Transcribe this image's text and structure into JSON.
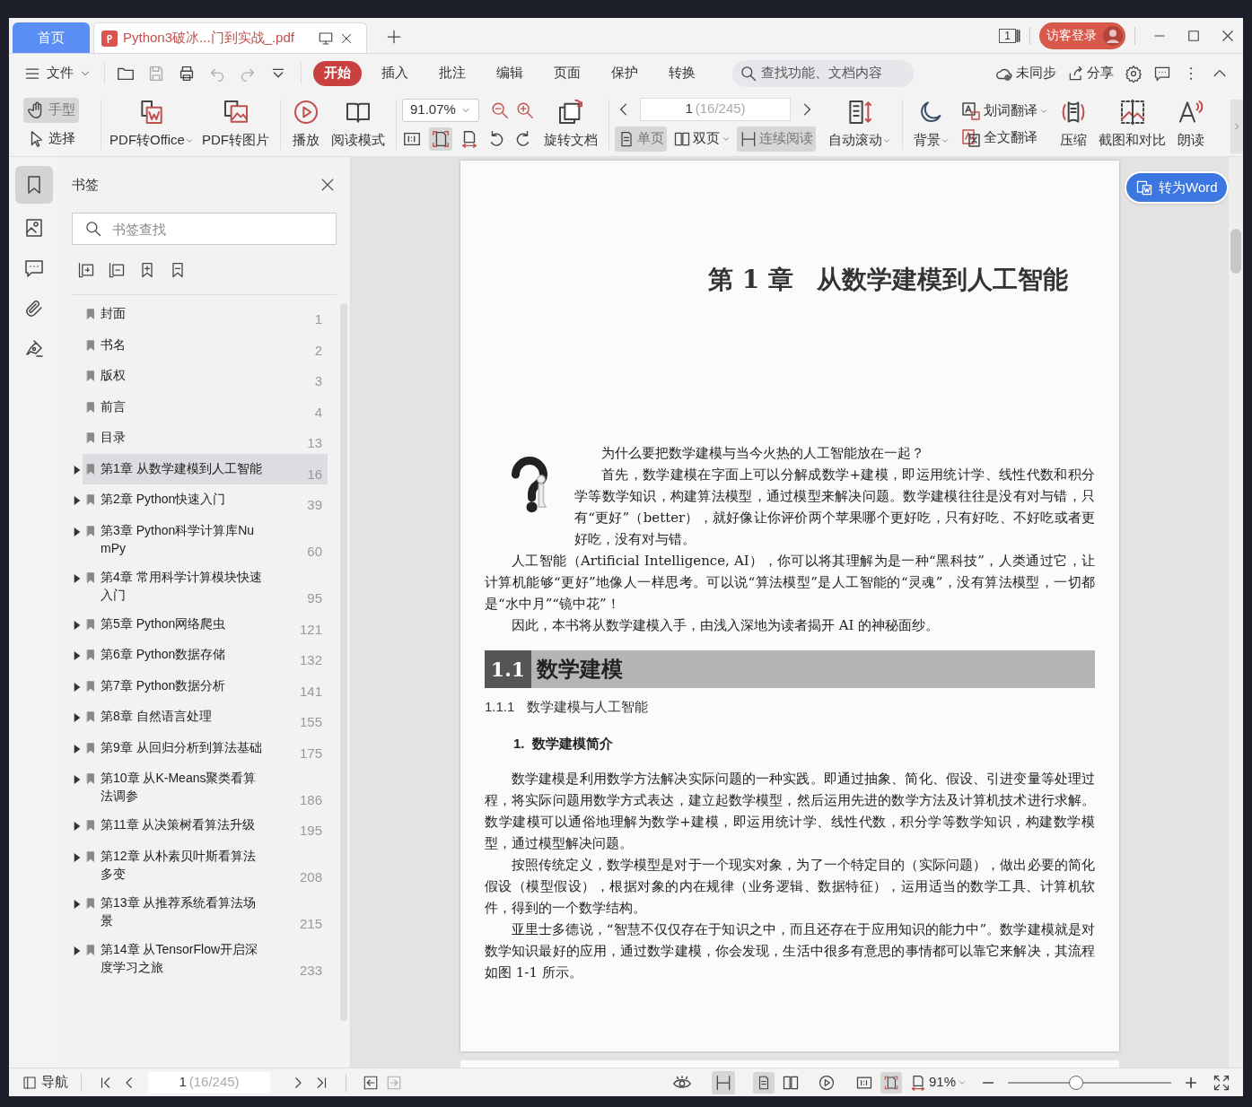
{
  "window": {
    "tabs": [
      {
        "label": "首页",
        "kind": "home",
        "selected": false
      },
      {
        "label": "Python3破冰...门到实战_.pdf",
        "kind": "document",
        "selected": true
      }
    ],
    "page_badge": "1",
    "login_button": "访客登录"
  },
  "menu": {
    "file": "文件",
    "ribbon_tabs": [
      {
        "label": "开始",
        "selected": true
      },
      {
        "label": "插入",
        "selected": false
      },
      {
        "label": "批注",
        "selected": false
      },
      {
        "label": "编辑",
        "selected": false
      },
      {
        "label": "页面",
        "selected": false
      },
      {
        "label": "保护",
        "selected": false
      },
      {
        "label": "转换",
        "selected": false
      }
    ],
    "search": {
      "placeholder": "查找功能、文档内容"
    },
    "sync": "未同步",
    "share": "分享"
  },
  "toolbar": {
    "pointer_tools": [
      {
        "label": "手型",
        "selected": true
      },
      {
        "label": "选择",
        "selected": false
      }
    ],
    "convert_tools": [
      {
        "label": "PDF转Office",
        "dropdown": true
      },
      {
        "label": "PDF转图片"
      },
      {
        "label": "播放"
      },
      {
        "label": "阅读模式"
      }
    ],
    "zoom": "91.07%",
    "rotate": "旋转文档",
    "page": {
      "value": "1",
      "total": "(16/245)"
    },
    "view_modes": [
      {
        "label": "单页",
        "selected": true
      },
      {
        "label": "双页",
        "selected": false,
        "dropdown": true
      },
      {
        "label": "连续阅读",
        "selected": true
      }
    ],
    "auto_scroll": "自动滚动",
    "background": "背景",
    "translate": [
      "划词翻译",
      "全文翻译"
    ],
    "more_tools": [
      "压缩",
      "截图和对比",
      "朗读"
    ]
  },
  "sidebar": {
    "title": "书签",
    "search": {
      "placeholder": "书签查找"
    },
    "bookmarks": [
      {
        "title": "封面",
        "page": "1",
        "has_children": false,
        "selected": false
      },
      {
        "title": "书名",
        "page": "2",
        "has_children": false,
        "selected": false
      },
      {
        "title": "版权",
        "page": "3",
        "has_children": false,
        "selected": false
      },
      {
        "title": "前言",
        "page": "4",
        "has_children": false,
        "selected": false
      },
      {
        "title": "目录",
        "page": "13",
        "has_children": false,
        "selected": false
      },
      {
        "title": "第1章 从数学建模到人工智能",
        "page": "16",
        "has_children": true,
        "selected": true
      },
      {
        "title": "第2章 Python快速入门",
        "page": "39",
        "has_children": true,
        "selected": false
      },
      {
        "title": "第3章 Python科学计算库NumPy",
        "page": "60",
        "has_children": true,
        "selected": false
      },
      {
        "title": "第4章 常用科学计算模块快速入门",
        "page": "95",
        "has_children": true,
        "selected": false
      },
      {
        "title": "第5章 Python网络爬虫",
        "page": "121",
        "has_children": true,
        "selected": false
      },
      {
        "title": "第6章 Python数据存储",
        "page": "132",
        "has_children": true,
        "selected": false
      },
      {
        "title": "第7章 Python数据分析",
        "page": "141",
        "has_children": true,
        "selected": false
      },
      {
        "title": "第8章 自然语言处理",
        "page": "155",
        "has_children": true,
        "selected": false
      },
      {
        "title": "第9章 从回归分析到算法基础",
        "page": "175",
        "has_children": true,
        "selected": false
      },
      {
        "title": "第10章 从K-Means聚类看算法调参",
        "page": "186",
        "has_children": true,
        "selected": false
      },
      {
        "title": "第11章 从决策树看算法升级",
        "page": "195",
        "has_children": true,
        "selected": false
      },
      {
        "title": "第12章 从朴素贝叶斯看算法多变",
        "page": "208",
        "has_children": true,
        "selected": false
      },
      {
        "title": "第13章 从推荐系统看算法场景",
        "page": "215",
        "has_children": true,
        "selected": false
      },
      {
        "title": "第14章 从TensorFlow开启深度学习之旅",
        "page": "233",
        "has_children": true,
        "selected": false
      }
    ]
  },
  "document": {
    "chapter_number": "第 1 章",
    "chapter_name": "从数学建模到人工智能",
    "intro": [
      "为什么要把数学建模与当今火热的人工智能放在一起？",
      "首先，数学建模在字面上可以分解成数学+建模，即运用统计学、线性代数和积分学等数学知识，构建算法模型，通过模型来解决问题。数学建模往往是没有对与错，只有“更好”（better），就好像让你评价两个苹果哪个更好吃，只有好吃、不好吃或者更好吃，没有对与错。",
      "人工智能（Artificial Intelligence, AI），你可以将其理解为是一种“黑科技”，人类通过它，让计算机能够“更好”地像人一样思考。可以说“算法模型”是人工智能的“灵魂”，没有算法模型，一切都是“水中月”“镜中花”！",
      "因此，本书将从数学建模入手，由浅入深地为读者揭开 AI 的神秘面纱。"
    ],
    "section": {
      "number": "1.1",
      "title": "数学建模"
    },
    "subsection": {
      "number": "1.1.1",
      "title": "数学建模与人工智能"
    },
    "heading": "1.  数学建模简介",
    "paragraphs": [
      "数学建模是利用数学方法解决实际问题的一种实践。即通过抽象、简化、假设、引进变量等处理过程，将实际问题用数学方式表达，建立起数学模型，然后运用先进的数学方法及计算机技术进行求解。数学建模可以通俗地理解为数学+建模，即运用统计学、线性代数，积分学等数学知识，构建数学模型，通过模型解决问题。",
      "按照传统定义，数学模型是对于一个现实对象，为了一个特定目的（实际问题），做出必要的简化假设（模型假设），根据对象的内在规律（业务逻辑、数据特征），运用适当的数学工具、计算机软件，得到的一个数学结构。",
      "亚里士多德说，“智慧不仅仅存在于知识之中，而且还存在于应用知识的能力中”。数学建模就是对数学知识最好的应用，通过数学建模，你会发现，生活中很多有意思的事情都可以靠它来解决，其流程如图 1-1 所示。"
    ]
  },
  "convert_button": "转为Word",
  "status_bar": {
    "nav": "导航",
    "page": {
      "value": "1",
      "total": "(16/245)"
    },
    "zoom": "91%",
    "zoom_slider": {
      "level": 0.42
    }
  }
}
